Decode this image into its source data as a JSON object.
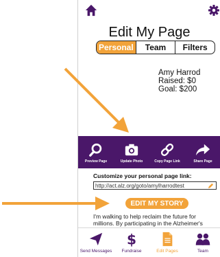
{
  "title": "Edit My Page",
  "tabs": [
    {
      "label": "Personal",
      "active": true
    },
    {
      "label": "Team",
      "active": false
    },
    {
      "label": "Filters",
      "active": false
    }
  ],
  "profile": {
    "name": "Amy Harrod",
    "raised": "Raised: $0",
    "goal": "Goal: $200"
  },
  "actions": [
    {
      "label": "Preview Page",
      "icon": "search-icon"
    },
    {
      "label": "Update Photo",
      "icon": "camera-icon"
    },
    {
      "label": "Copy Page Link",
      "icon": "link-icon"
    },
    {
      "label": "Share Page",
      "icon": "share-icon"
    }
  ],
  "customize": {
    "label": "Customize your personal page link:",
    "url": "http://act.alz.org/goto/amylharrodtest"
  },
  "edit_story_label": "EDIT MY STORY",
  "story_text": "I'm walking to help reclaim the future for millions. By participating in the Alzheimer's",
  "bottom_nav": [
    {
      "label": "Send Messages",
      "icon": "send-icon",
      "active": false
    },
    {
      "label": "Fundraise",
      "icon": "dollar-icon",
      "active": false
    },
    {
      "label": "Edit Pages",
      "icon": "document-icon",
      "active": true
    },
    {
      "label": "Team",
      "icon": "team-icon",
      "active": false
    }
  ],
  "colors": {
    "brand_purple": "#4a1769",
    "accent_orange": "#f2a33a"
  }
}
